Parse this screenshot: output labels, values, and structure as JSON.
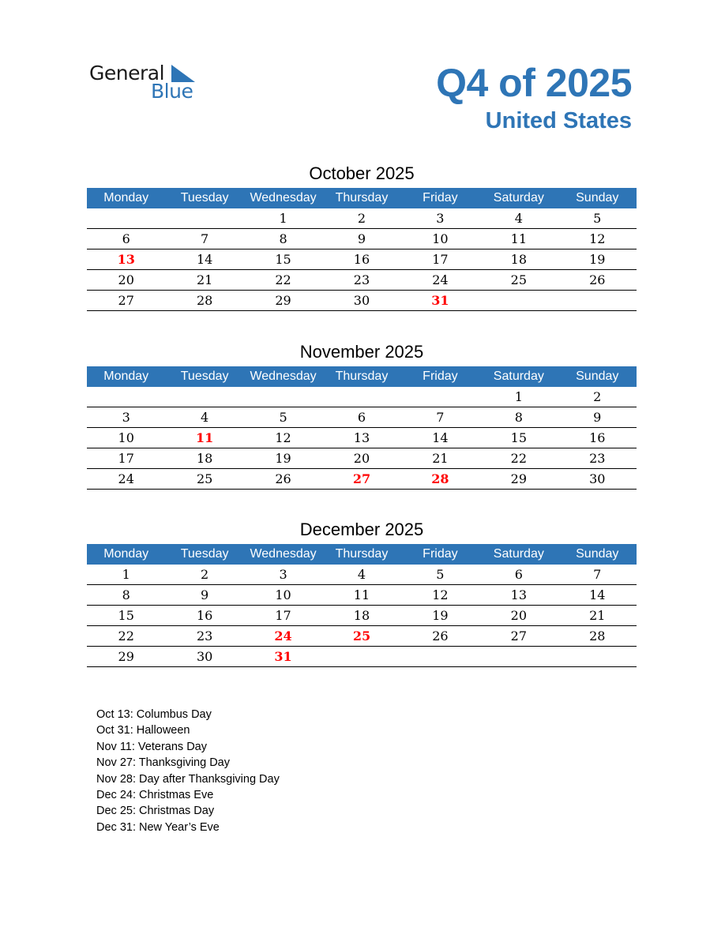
{
  "logo": {
    "line1": "General",
    "line2": "Blue"
  },
  "header": {
    "title": "Q4 of 2025",
    "subtitle": "United States"
  },
  "colors": {
    "accent": "#2e75b6",
    "holiday": "#ff0000"
  },
  "weekdays": [
    "Monday",
    "Tuesday",
    "Wednesday",
    "Thursday",
    "Friday",
    "Saturday",
    "Sunday"
  ],
  "months": [
    {
      "title": "October 2025",
      "weeks": [
        [
          "",
          "",
          "1",
          "2",
          "3",
          "4",
          "5"
        ],
        [
          "6",
          "7",
          "8",
          "9",
          "10",
          "11",
          "12"
        ],
        [
          "13",
          "14",
          "15",
          "16",
          "17",
          "18",
          "19"
        ],
        [
          "20",
          "21",
          "22",
          "23",
          "24",
          "25",
          "26"
        ],
        [
          "27",
          "28",
          "29",
          "30",
          "31",
          "",
          ""
        ]
      ],
      "holidays": [
        "13",
        "31"
      ]
    },
    {
      "title": "November 2025",
      "weeks": [
        [
          "",
          "",
          "",
          "",
          "",
          "1",
          "2"
        ],
        [
          "3",
          "4",
          "5",
          "6",
          "7",
          "8",
          "9"
        ],
        [
          "10",
          "11",
          "12",
          "13",
          "14",
          "15",
          "16"
        ],
        [
          "17",
          "18",
          "19",
          "20",
          "21",
          "22",
          "23"
        ],
        [
          "24",
          "25",
          "26",
          "27",
          "28",
          "29",
          "30"
        ]
      ],
      "holidays": [
        "11",
        "27",
        "28"
      ]
    },
    {
      "title": "December 2025",
      "weeks": [
        [
          "1",
          "2",
          "3",
          "4",
          "5",
          "6",
          "7"
        ],
        [
          "8",
          "9",
          "10",
          "11",
          "12",
          "13",
          "14"
        ],
        [
          "15",
          "16",
          "17",
          "18",
          "19",
          "20",
          "21"
        ],
        [
          "22",
          "23",
          "24",
          "25",
          "26",
          "27",
          "28"
        ],
        [
          "29",
          "30",
          "31",
          "",
          "",
          "",
          ""
        ]
      ],
      "holidays": [
        "24",
        "25",
        "31"
      ]
    }
  ],
  "holiday_list": [
    "Oct 13: Columbus Day",
    "Oct 31: Halloween",
    "Nov 11: Veterans Day",
    "Nov 27: Thanksgiving Day",
    "Nov 28: Day after Thanksgiving Day",
    "Dec 24: Christmas Eve",
    "Dec 25: Christmas Day",
    "Dec 31: New Year’s Eve"
  ]
}
